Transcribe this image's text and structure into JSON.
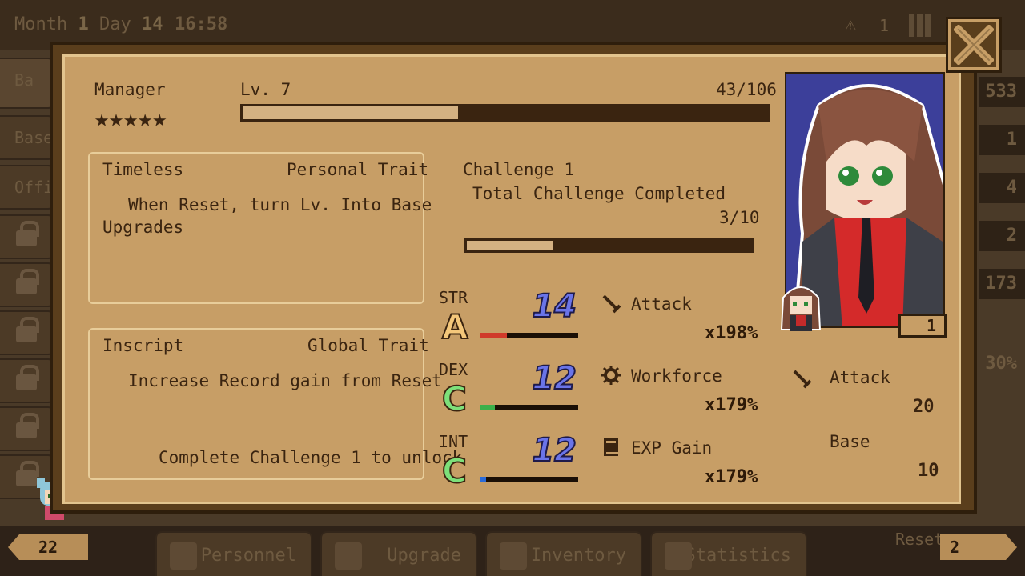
{
  "background": {
    "date_label": "Month",
    "month": "1",
    "day_label": "Day",
    "day": "14",
    "time": "16:58",
    "alert_count": "1",
    "sidebar_items": [
      "Ba",
      "Base",
      "Offi"
    ],
    "right_values": [
      "533",
      "1",
      "4",
      "2",
      "173",
      "30%"
    ],
    "bottom_tabs": [
      "Personnel",
      "Upgrade",
      "Inventory",
      "Statistics"
    ],
    "left_count": "22",
    "right_count": "2",
    "reset_label": "Reset"
  },
  "header": {
    "role": "Manager",
    "stars": "★★★★★",
    "level_label": "Lv. 7",
    "exp_text": "43/106",
    "exp_fraction": 0.41
  },
  "traits": [
    {
      "name": "Timeless",
      "type": "Personal Trait",
      "description_line1": "When Reset, turn Lv. Into Base",
      "description_line2": "Upgrades",
      "footer": ""
    },
    {
      "name": "Inscript",
      "type": "Global Trait",
      "description_line1": "Increase Record gain from Reset",
      "description_line2": "",
      "footer": "Complete Challenge 1 to unlock"
    }
  ],
  "challenge": {
    "title": "Challenge 1",
    "subtitle": "Total Challenge Completed",
    "progress_text": "3/10",
    "progress_fraction": 0.3
  },
  "stats": [
    {
      "label": "STR",
      "grade": "A",
      "value": "14",
      "grade_color": "#f4c77a",
      "bar_color": "#d03a2a",
      "bar_fraction": 0.27,
      "effect": "Attack",
      "effect_icon": "sword-icon",
      "multiplier": "x198%"
    },
    {
      "label": "DEX",
      "grade": "C",
      "value": "12",
      "grade_color": "#7de07a",
      "bar_color": "#3ab04a",
      "bar_fraction": 0.15,
      "effect": "Workforce",
      "effect_icon": "gear-icon",
      "multiplier": "x179%"
    },
    {
      "label": "INT",
      "grade": "C",
      "value": "12",
      "grade_color": "#7de07a",
      "bar_color": "#2a6ad8",
      "bar_fraction": 0.06,
      "effect": "EXP Gain",
      "effect_icon": "book-icon",
      "multiplier": "x179%"
    }
  ],
  "side_info": {
    "attack_label": "Attack",
    "attack_value": "20",
    "base_label": "Base",
    "base_value": "10"
  },
  "portrait": {
    "level_badge": "1"
  },
  "colors": {
    "panel_bg": "#c79e66",
    "frame": "#5a3e1c",
    "dark_text": "#3a2410",
    "stat_number": "#6a74e8"
  }
}
